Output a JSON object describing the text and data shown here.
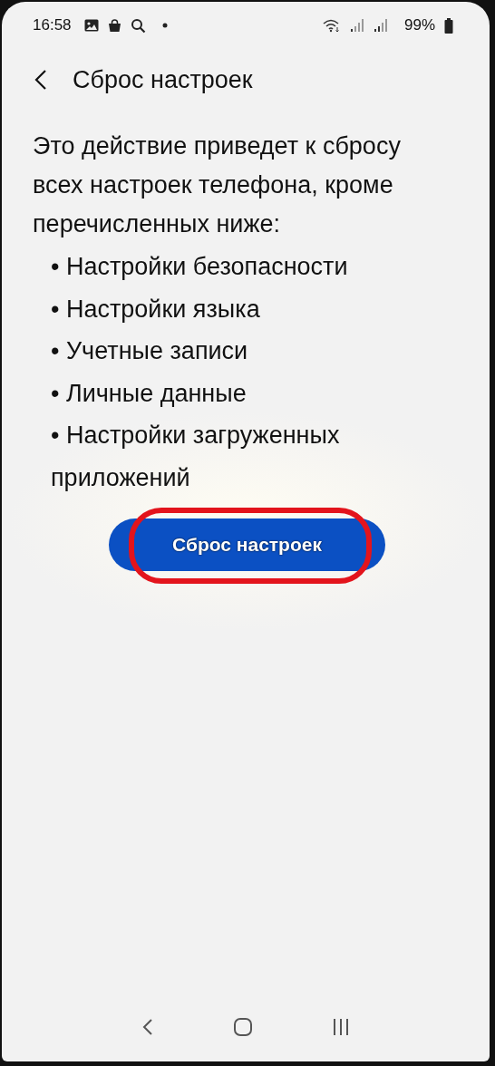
{
  "status_bar": {
    "time": "16:58",
    "battery": "99%"
  },
  "header": {
    "title": "Сброс настроек"
  },
  "description": "Это действие приведет к сбросу всех настроек телефона, кроме перечисленных ниже:",
  "items": [
    "• Настройки безопасности",
    "• Настройки языка",
    "• Учетные записи",
    "• Личные данные",
    "• Настройки загруженных приложений"
  ],
  "reset_button": {
    "label": "Сброс настроек",
    "highlighted": true
  }
}
